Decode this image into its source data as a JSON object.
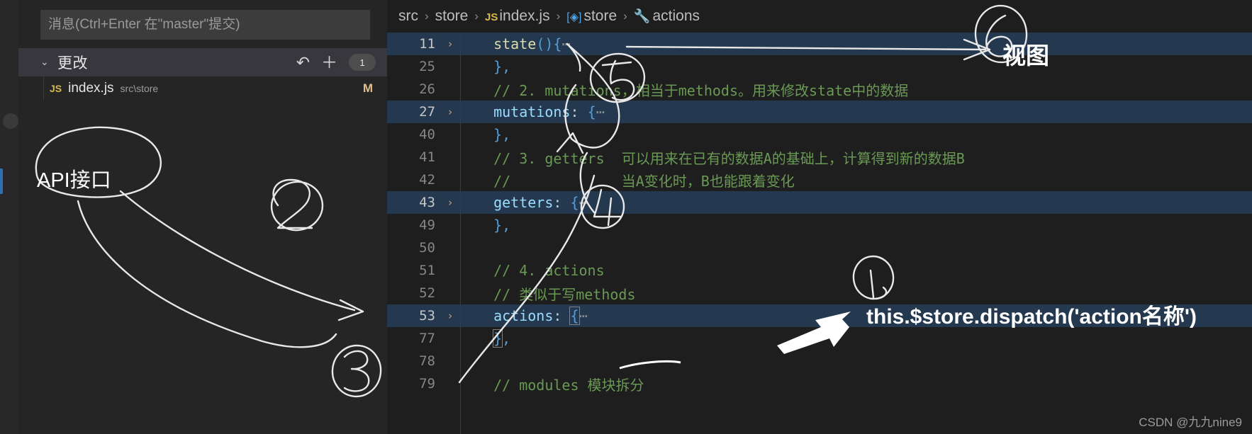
{
  "sidebar": {
    "commit_input": {
      "value": "",
      "placeholder": "消息(Ctrl+Enter 在\"master\"提交)"
    },
    "section": {
      "chevron": "⌄",
      "title": "更改",
      "undo_icon": "↶",
      "add_icon": "＋",
      "count": "1"
    },
    "changes": [
      {
        "type_badge": "JS",
        "name": "index.js",
        "path": "src\\store",
        "status": "M"
      }
    ]
  },
  "breadcrumb": {
    "items": [
      {
        "label": "src",
        "icon": ""
      },
      {
        "label": "store",
        "icon": ""
      },
      {
        "label": "index.js",
        "icon": "JS"
      },
      {
        "label": "store",
        "icon": "cube"
      },
      {
        "label": "actions",
        "icon": "wrench"
      }
    ],
    "separator": "›"
  },
  "editor": {
    "lines": [
      {
        "num": "11",
        "fold": "›",
        "highlight": true,
        "tokens": [
          {
            "t": "  ",
            "c": "plain"
          },
          {
            "t": "state",
            "c": "kw"
          },
          {
            "t": "()",
            "c": "punc"
          },
          {
            "t": "{",
            "c": "punc"
          },
          {
            "t": "⋯",
            "c": "dots"
          }
        ]
      },
      {
        "num": "25",
        "fold": "",
        "highlight": false,
        "tokens": [
          {
            "t": "  ",
            "c": "plain"
          },
          {
            "t": "}",
            "c": "punc"
          },
          {
            "t": ",",
            "c": "punc"
          }
        ]
      },
      {
        "num": "26",
        "fold": "",
        "highlight": false,
        "tokens": [
          {
            "t": "  // 2. mutations，相当于methods。用来修改state中的数据",
            "c": "cmt"
          }
        ]
      },
      {
        "num": "27",
        "fold": "›",
        "highlight": true,
        "tokens": [
          {
            "t": "  ",
            "c": "plain"
          },
          {
            "t": "mutations",
            "c": "prop"
          },
          {
            "t": ": ",
            "c": "plain"
          },
          {
            "t": "{",
            "c": "punc"
          },
          {
            "t": "⋯",
            "c": "dots"
          }
        ]
      },
      {
        "num": "40",
        "fold": "",
        "highlight": false,
        "tokens": [
          {
            "t": "  ",
            "c": "plain"
          },
          {
            "t": "}",
            "c": "punc"
          },
          {
            "t": ",",
            "c": "punc"
          }
        ]
      },
      {
        "num": "41",
        "fold": "",
        "highlight": false,
        "tokens": [
          {
            "t": "  // 3. getters  可以用来在已有的数据A的基础上，计算得到新的数据B",
            "c": "cmt"
          }
        ]
      },
      {
        "num": "42",
        "fold": "",
        "highlight": false,
        "tokens": [
          {
            "t": "  //             当A变化时，B也能跟着变化",
            "c": "cmt"
          }
        ]
      },
      {
        "num": "43",
        "fold": "›",
        "highlight": true,
        "tokens": [
          {
            "t": "  ",
            "c": "plain"
          },
          {
            "t": "getters",
            "c": "prop"
          },
          {
            "t": ": ",
            "c": "plain"
          },
          {
            "t": "{",
            "c": "punc"
          },
          {
            "t": "⋯",
            "c": "dots"
          }
        ]
      },
      {
        "num": "49",
        "fold": "",
        "highlight": false,
        "tokens": [
          {
            "t": "  ",
            "c": "plain"
          },
          {
            "t": "}",
            "c": "punc"
          },
          {
            "t": ",",
            "c": "punc"
          }
        ]
      },
      {
        "num": "50",
        "fold": "",
        "highlight": false,
        "tokens": [
          {
            "t": "",
            "c": "plain"
          }
        ]
      },
      {
        "num": "51",
        "fold": "",
        "highlight": false,
        "tokens": [
          {
            "t": "  // 4. actions",
            "c": "cmt"
          }
        ]
      },
      {
        "num": "52",
        "fold": "",
        "highlight": false,
        "tokens": [
          {
            "t": "  // 类似于写methods",
            "c": "cmt"
          }
        ]
      },
      {
        "num": "53",
        "fold": "›",
        "highlight": true,
        "tokens": [
          {
            "t": "  ",
            "c": "plain"
          },
          {
            "t": "actions",
            "c": "prop"
          },
          {
            "t": ": ",
            "c": "plain"
          },
          {
            "t": "{",
            "c": "punc-match"
          },
          {
            "t": "⋯",
            "c": "dots"
          }
        ]
      },
      {
        "num": "77",
        "fold": "",
        "highlight": false,
        "tokens": [
          {
            "t": "  ",
            "c": "plain"
          },
          {
            "t": "}",
            "c": "punc-match"
          },
          {
            "t": ",",
            "c": "punc"
          }
        ]
      },
      {
        "num": "78",
        "fold": "",
        "highlight": false,
        "tokens": [
          {
            "t": "",
            "c": "plain"
          }
        ]
      },
      {
        "num": "79",
        "fold": "",
        "highlight": false,
        "tokens": [
          {
            "t": "  // modules 模块拆分",
            "c": "cmt"
          }
        ]
      }
    ]
  },
  "annotations": {
    "api_label": "API接口",
    "view_label": "视图",
    "dispatch_label": "this.$store.dispatch('action名称')",
    "handwritten_numbers": [
      "1",
      "2",
      "3",
      "4",
      "5",
      "6"
    ]
  },
  "watermark": "CSDN @九九nine9",
  "colors": {
    "editor_bg": "#1e1e1e",
    "sidebar_bg": "#252526",
    "highlight_line": "#24394f",
    "comment": "#6a9955",
    "property": "#9cdcfe",
    "keyword": "#dcdcaa",
    "punctuation": "#569cd6",
    "status_modified": "#e2c08d",
    "annotation": "#ffffff"
  }
}
